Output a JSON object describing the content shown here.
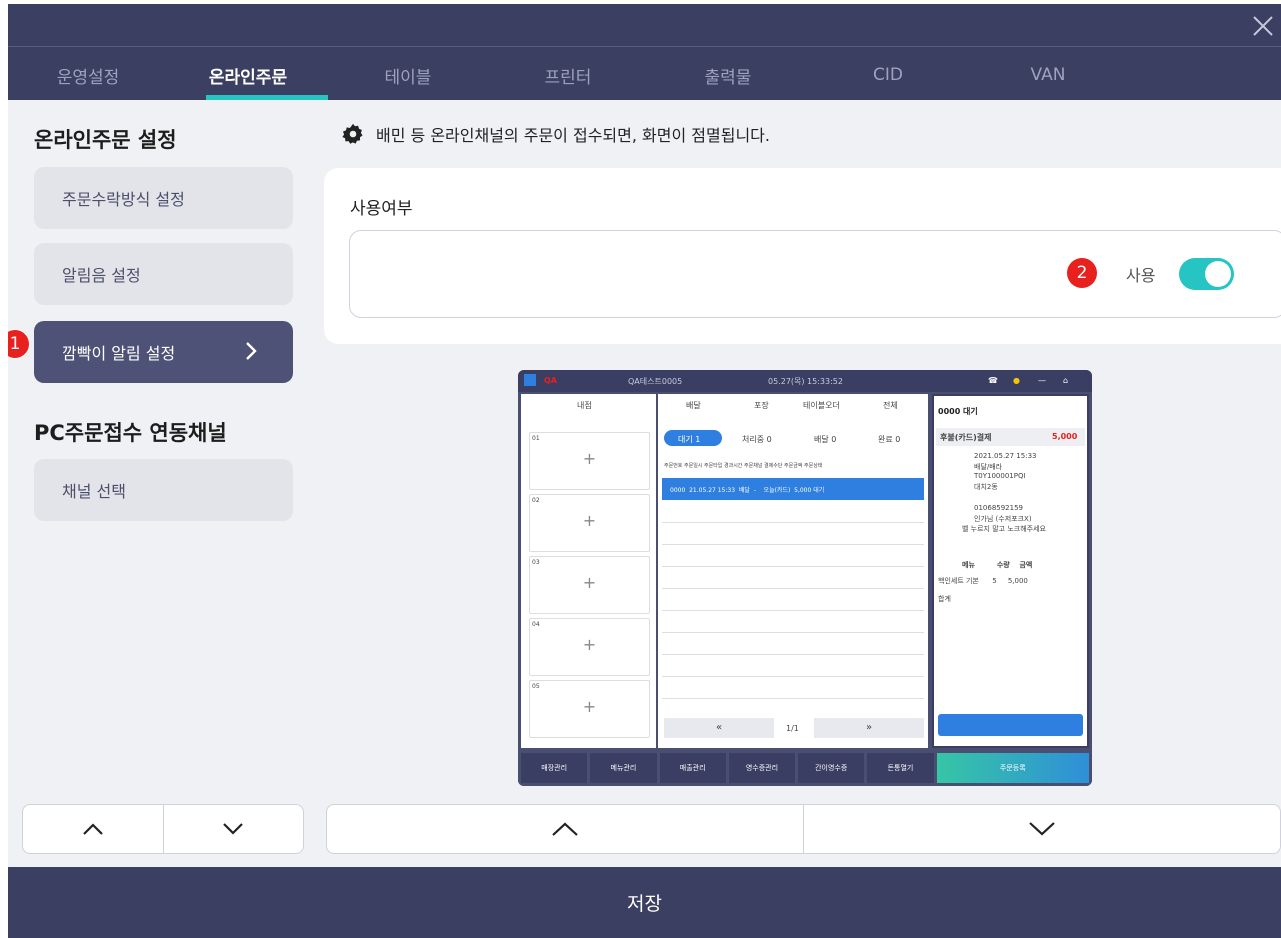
{
  "tabs": [
    "운영설정",
    "온라인주문",
    "테이블",
    "프린터",
    "출력물",
    "CID",
    "VAN"
  ],
  "sidebar": {
    "section1_title": "온라인주문 설정",
    "items1": [
      "주문수락방식 설정",
      "알림음 설정",
      "깜빡이 알림 설정"
    ],
    "section2_title": "PC주문접수 연동채널",
    "items2": [
      "채널 선택"
    ],
    "badge": "1"
  },
  "main": {
    "description": "배민 등 온라인채널의 주문이 접수되면, 화면이 점멸됩니다.",
    "section_label": "사용여부",
    "badge": "2",
    "toggle_label": "사용",
    "toggle_on": true
  },
  "preview": {
    "store": "QA",
    "store_name": "QA테스트0005",
    "datetime": "05.27(목) 15:33:52",
    "left_header": "내점",
    "tabs": [
      "배달",
      "포장",
      "테이블오더",
      "전체"
    ],
    "status_tabs": [
      "대기 1",
      "처리중 0",
      "배달 0",
      "완료 0"
    ],
    "columns": [
      "주문번호",
      "주문일시",
      "주문타입",
      "경과시간",
      "주문채널",
      "결제수단",
      "주문금액",
      "주문상태"
    ],
    "row": [
      "0000",
      "21.05.27 15:33",
      "배달",
      "-",
      "",
      "오늘(카드)",
      "5,000",
      "대기"
    ],
    "slots": [
      "01",
      "02",
      "03",
      "04",
      "05"
    ],
    "pager": "1/1",
    "order_title": "0000 대기",
    "payment": "후불(카드)결제",
    "amount": "5,000",
    "details": [
      "2021.05.27 15:33",
      "배달/배라",
      "T0Y100001PQI",
      "대치2동",
      "01068592159",
      "인가님 (수저포크X)",
      "벨 누르지 말고 노크해주세요"
    ],
    "menu_header": [
      "메뉴",
      "수량",
      "금액"
    ],
    "menu_item": [
      "핵인세트 기본",
      "5",
      "5,000"
    ],
    "total_label": "합계",
    "bottom_buttons": [
      "매장관리",
      "메뉴관리",
      "매출관리",
      "영수증관리",
      "간이영수증",
      "돈통열기",
      "주문등록"
    ]
  },
  "save_label": "저장"
}
